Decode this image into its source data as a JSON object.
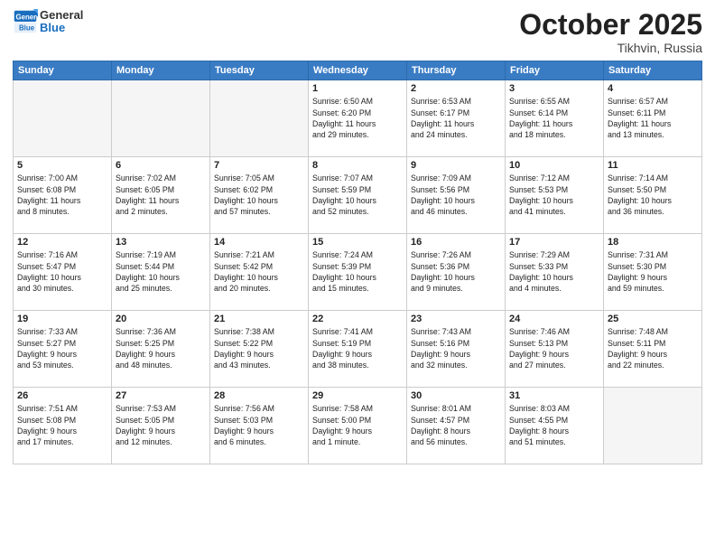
{
  "header": {
    "logo_general": "General",
    "logo_blue": "Blue",
    "month": "October 2025",
    "location": "Tikhvin, Russia"
  },
  "days_of_week": [
    "Sunday",
    "Monday",
    "Tuesday",
    "Wednesday",
    "Thursday",
    "Friday",
    "Saturday"
  ],
  "weeks": [
    [
      {
        "day": "",
        "info": ""
      },
      {
        "day": "",
        "info": ""
      },
      {
        "day": "",
        "info": ""
      },
      {
        "day": "1",
        "info": "Sunrise: 6:50 AM\nSunset: 6:20 PM\nDaylight: 11 hours\nand 29 minutes."
      },
      {
        "day": "2",
        "info": "Sunrise: 6:53 AM\nSunset: 6:17 PM\nDaylight: 11 hours\nand 24 minutes."
      },
      {
        "day": "3",
        "info": "Sunrise: 6:55 AM\nSunset: 6:14 PM\nDaylight: 11 hours\nand 18 minutes."
      },
      {
        "day": "4",
        "info": "Sunrise: 6:57 AM\nSunset: 6:11 PM\nDaylight: 11 hours\nand 13 minutes."
      }
    ],
    [
      {
        "day": "5",
        "info": "Sunrise: 7:00 AM\nSunset: 6:08 PM\nDaylight: 11 hours\nand 8 minutes."
      },
      {
        "day": "6",
        "info": "Sunrise: 7:02 AM\nSunset: 6:05 PM\nDaylight: 11 hours\nand 2 minutes."
      },
      {
        "day": "7",
        "info": "Sunrise: 7:05 AM\nSunset: 6:02 PM\nDaylight: 10 hours\nand 57 minutes."
      },
      {
        "day": "8",
        "info": "Sunrise: 7:07 AM\nSunset: 5:59 PM\nDaylight: 10 hours\nand 52 minutes."
      },
      {
        "day": "9",
        "info": "Sunrise: 7:09 AM\nSunset: 5:56 PM\nDaylight: 10 hours\nand 46 minutes."
      },
      {
        "day": "10",
        "info": "Sunrise: 7:12 AM\nSunset: 5:53 PM\nDaylight: 10 hours\nand 41 minutes."
      },
      {
        "day": "11",
        "info": "Sunrise: 7:14 AM\nSunset: 5:50 PM\nDaylight: 10 hours\nand 36 minutes."
      }
    ],
    [
      {
        "day": "12",
        "info": "Sunrise: 7:16 AM\nSunset: 5:47 PM\nDaylight: 10 hours\nand 30 minutes."
      },
      {
        "day": "13",
        "info": "Sunrise: 7:19 AM\nSunset: 5:44 PM\nDaylight: 10 hours\nand 25 minutes."
      },
      {
        "day": "14",
        "info": "Sunrise: 7:21 AM\nSunset: 5:42 PM\nDaylight: 10 hours\nand 20 minutes."
      },
      {
        "day": "15",
        "info": "Sunrise: 7:24 AM\nSunset: 5:39 PM\nDaylight: 10 hours\nand 15 minutes."
      },
      {
        "day": "16",
        "info": "Sunrise: 7:26 AM\nSunset: 5:36 PM\nDaylight: 10 hours\nand 9 minutes."
      },
      {
        "day": "17",
        "info": "Sunrise: 7:29 AM\nSunset: 5:33 PM\nDaylight: 10 hours\nand 4 minutes."
      },
      {
        "day": "18",
        "info": "Sunrise: 7:31 AM\nSunset: 5:30 PM\nDaylight: 9 hours\nand 59 minutes."
      }
    ],
    [
      {
        "day": "19",
        "info": "Sunrise: 7:33 AM\nSunset: 5:27 PM\nDaylight: 9 hours\nand 53 minutes."
      },
      {
        "day": "20",
        "info": "Sunrise: 7:36 AM\nSunset: 5:25 PM\nDaylight: 9 hours\nand 48 minutes."
      },
      {
        "day": "21",
        "info": "Sunrise: 7:38 AM\nSunset: 5:22 PM\nDaylight: 9 hours\nand 43 minutes."
      },
      {
        "day": "22",
        "info": "Sunrise: 7:41 AM\nSunset: 5:19 PM\nDaylight: 9 hours\nand 38 minutes."
      },
      {
        "day": "23",
        "info": "Sunrise: 7:43 AM\nSunset: 5:16 PM\nDaylight: 9 hours\nand 32 minutes."
      },
      {
        "day": "24",
        "info": "Sunrise: 7:46 AM\nSunset: 5:13 PM\nDaylight: 9 hours\nand 27 minutes."
      },
      {
        "day": "25",
        "info": "Sunrise: 7:48 AM\nSunset: 5:11 PM\nDaylight: 9 hours\nand 22 minutes."
      }
    ],
    [
      {
        "day": "26",
        "info": "Sunrise: 7:51 AM\nSunset: 5:08 PM\nDaylight: 9 hours\nand 17 minutes."
      },
      {
        "day": "27",
        "info": "Sunrise: 7:53 AM\nSunset: 5:05 PM\nDaylight: 9 hours\nand 12 minutes."
      },
      {
        "day": "28",
        "info": "Sunrise: 7:56 AM\nSunset: 5:03 PM\nDaylight: 9 hours\nand 6 minutes."
      },
      {
        "day": "29",
        "info": "Sunrise: 7:58 AM\nSunset: 5:00 PM\nDaylight: 9 hours\nand 1 minute."
      },
      {
        "day": "30",
        "info": "Sunrise: 8:01 AM\nSunset: 4:57 PM\nDaylight: 8 hours\nand 56 minutes."
      },
      {
        "day": "31",
        "info": "Sunrise: 8:03 AM\nSunset: 4:55 PM\nDaylight: 8 hours\nand 51 minutes."
      },
      {
        "day": "",
        "info": ""
      }
    ]
  ]
}
